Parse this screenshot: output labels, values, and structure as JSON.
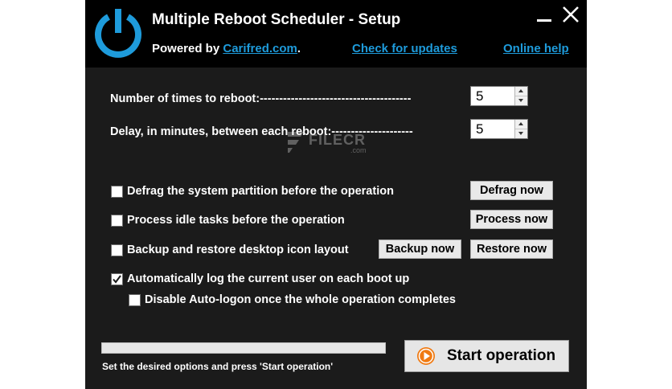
{
  "window": {
    "title": "Multiple Reboot Scheduler - Setup",
    "powered_by_prefix": "Powered by ",
    "powered_by_link": "Carifred.com",
    "powered_by_suffix": ".",
    "check_updates_label": "Check for updates",
    "online_help_label": "Online help",
    "accent_color": "#1e9bdb",
    "logo_icon": "power-icon",
    "minimize_icon": "minimize-icon",
    "close_icon": "close-icon"
  },
  "settings": {
    "reboot_count_label": "Number of times to reboot:---------------------------------------",
    "reboot_count_value": "5",
    "delay_label": "Delay, in minutes, between each reboot:---------------------",
    "delay_value": "5"
  },
  "options": {
    "defrag_label": "Defrag the system partition before the operation",
    "defrag_checked": false,
    "defrag_button": "Defrag now",
    "idle_label": "Process idle tasks before the operation",
    "idle_checked": false,
    "idle_button": "Process now",
    "backup_label": "Backup and restore desktop icon layout",
    "backup_checked": false,
    "backup_button": "Backup now",
    "restore_button": "Restore now",
    "autologon_label": "Automatically log the current user on each boot up",
    "autologon_checked": true,
    "disable_autologon_label": "Disable Auto-logon once the whole operation completes",
    "disable_autologon_checked": false
  },
  "footer": {
    "progress": 0,
    "status_text": "Set the desired options and press 'Start operation'",
    "start_label": "Start operation",
    "start_icon": "play-icon",
    "start_icon_color": "#f07a12"
  },
  "watermark": {
    "text": "FILECR",
    "sub": ".com"
  }
}
